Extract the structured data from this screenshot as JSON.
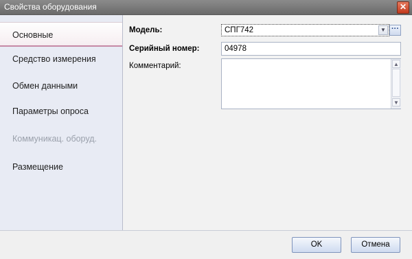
{
  "window": {
    "title": "Свойства оборудования"
  },
  "sidebar": {
    "items": [
      {
        "label": "Основные",
        "active": true
      },
      {
        "label": "Средство измерения"
      },
      {
        "label": "Обмен данными"
      },
      {
        "label": "Параметры опроса"
      },
      {
        "label": "Коммуникац. оборуд.",
        "disabled": true
      },
      {
        "label": "Размещение"
      }
    ]
  },
  "form": {
    "model": {
      "label": "Модель:",
      "value": "СПГ742"
    },
    "serial": {
      "label": "Серийный номер:",
      "value": "04978"
    },
    "comment": {
      "label": "Комментарий:",
      "value": ""
    }
  },
  "buttons": {
    "ok": "OK",
    "cancel": "Отмена"
  },
  "colors": {
    "titlebar": "#7a7a7a",
    "sidebar": "#e8ebf4",
    "close": "#c43a1d"
  },
  "icons": {
    "close": "close-icon",
    "combo": "chevron-down-icon",
    "lookup": "ellipsis-icon"
  }
}
